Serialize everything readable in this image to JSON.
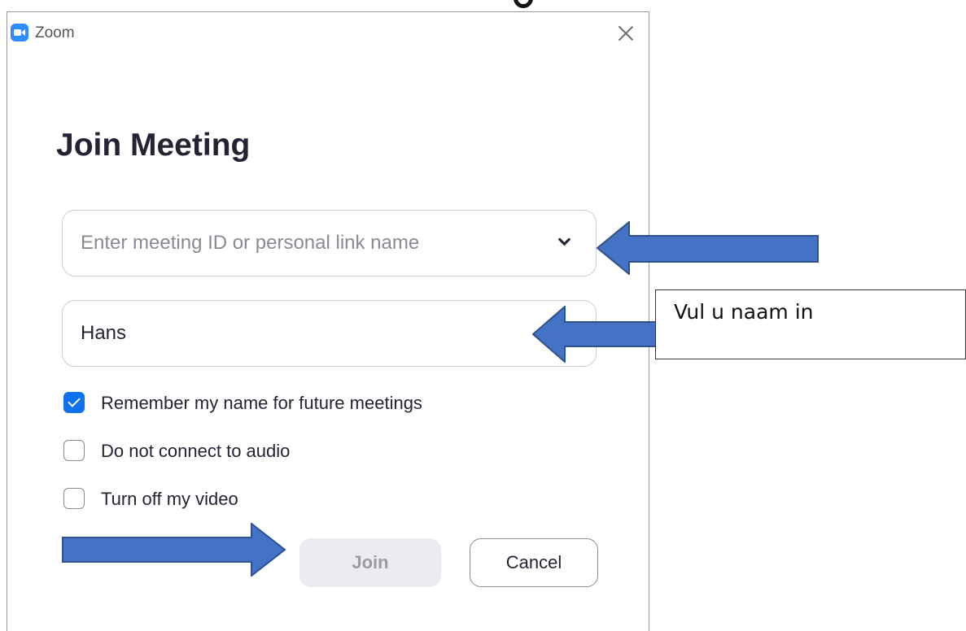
{
  "window": {
    "app_title": "Zoom",
    "logo_icon": "zoom-camera-icon",
    "close_icon": "close-icon"
  },
  "dialog": {
    "heading": "Join Meeting",
    "meeting_id_field": {
      "value": "",
      "placeholder": "Enter meeting ID or personal link name",
      "dropdown_icon": "chevron-down-icon"
    },
    "name_field": {
      "value": "Hans",
      "placeholder": ""
    },
    "options": [
      {
        "label": "Remember my name for future meetings",
        "checked": true
      },
      {
        "label": "Do not connect to audio",
        "checked": false
      },
      {
        "label": "Turn off my video",
        "checked": false
      }
    ],
    "buttons": {
      "join_label": "Join",
      "cancel_label": "Cancel"
    }
  },
  "annotations": {
    "callout_text": "Vul u naam in",
    "arrow_color": "#4472c4",
    "arrow_outline_color": "#2f528f"
  },
  "colors": {
    "accent": "#0e72ed",
    "zoom_blue": "#2d8cff",
    "heading": "#232333"
  }
}
